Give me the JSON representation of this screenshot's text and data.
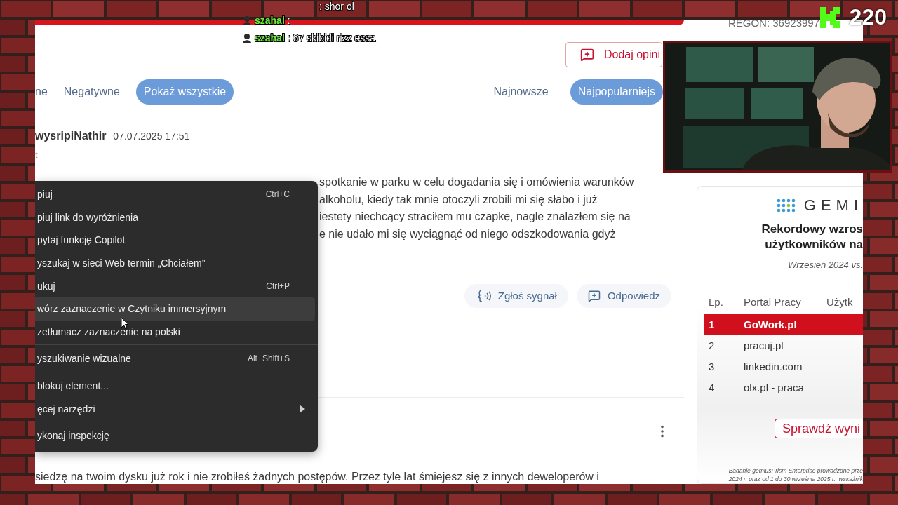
{
  "stream": {
    "viewer_count": "220"
  },
  "chat": [
    {
      "text": ": shor ol"
    },
    {
      "user": "szahal",
      "text": ":"
    },
    {
      "user": "szahal",
      "text": ": 67 skibidi rizz essa"
    }
  ],
  "page": {
    "regon": "REGON: 36923997",
    "add_review_button": "Dodaj opini",
    "filters": [
      {
        "label": "ne",
        "selected": false
      },
      {
        "label": "Negatywne",
        "selected": false
      },
      {
        "label": "Pokaż wszystkie",
        "selected": true
      }
    ],
    "sort": [
      {
        "label": "Najnowsze",
        "selected": false
      },
      {
        "label": "Najpopularniejs",
        "selected": true
      }
    ],
    "review": {
      "author": "wysripiNathir",
      "date": "07.07.2025 17:51",
      "subtitle": "t",
      "lines": [
        "spotkanie w parku w celu dogadania się i omówienia warunków",
        "alkoholu, kiedy tak mnie otoczyli zrobili mi się słabo i już",
        "iestety niechcący straciłem mu czapkę, nagle znalazłem się na",
        "e nie udało mi się wyciągnąć od niego odszkodowania gdyż"
      ],
      "actions": [
        {
          "kind": "report",
          "label": "Zgłoś sygnał"
        },
        {
          "kind": "reply",
          "label": "Odpowiedz"
        }
      ]
    },
    "next_review": {
      "text": "siedzę na twoim dysku już rok i nie zrobiłeś żadnych postępów. Przez tyle lat śmiejesz się z innych deweloperów i"
    }
  },
  "ad": {
    "logo": "GEMI",
    "title_lines": [
      "Rekordowy wzros",
      "użytkowników na"
    ],
    "subtitle": "Wrzesień 2024 vs.",
    "columns": [
      "Lp.",
      "Portal Pracy",
      "Użytk"
    ],
    "rows": [
      {
        "rank": "1",
        "portal": "GoWork.pl",
        "selected": true
      },
      {
        "rank": "2",
        "portal": "pracuj.pl",
        "selected": false
      },
      {
        "rank": "3",
        "portal": "linkedin.com",
        "selected": false
      },
      {
        "rank": "4",
        "portal": "olx.pl - praca",
        "selected": false
      }
    ],
    "button": "Sprawdź wyni",
    "footnote_lines": [
      "Badanie gemiusPrism Enterprise prowadzone prze",
      "2024 r. oraz od 1 do 30 września 2025 r.; wskaźnik"
    ]
  },
  "context_menu": {
    "items": [
      {
        "kind": "item",
        "label": "piuj",
        "shortcut": "Ctrl+C",
        "selected": false
      },
      {
        "kind": "item",
        "label": "piuj link do wyróżnienia",
        "selected": false
      },
      {
        "kind": "item",
        "label": "pytaj funkcję Copilot",
        "selected": false
      },
      {
        "kind": "item",
        "label": "yszukaj w sieci Web termin „Chciałem”",
        "selected": false
      },
      {
        "kind": "item",
        "label": "ukuj",
        "shortcut": "Ctrl+P",
        "selected": false
      },
      {
        "kind": "item",
        "label": "wórz zaznaczenie w Czytniku immersyjnym",
        "selected": true
      },
      {
        "kind": "item",
        "label": "zetłumacz zaznaczenie na polski",
        "selected": false
      },
      {
        "kind": "separator"
      },
      {
        "kind": "item",
        "label": "yszukiwanie wizualne",
        "shortcut": "Alt+Shift+S",
        "selected": false
      },
      {
        "kind": "separator"
      },
      {
        "kind": "item",
        "label": "blokuj element...",
        "selected": false
      },
      {
        "kind": "item",
        "label": "ęcej narzędzi",
        "submenu": true,
        "selected": false
      },
      {
        "kind": "separator"
      },
      {
        "kind": "item",
        "label": "ykonaj inspekcję",
        "selected": false
      }
    ]
  }
}
